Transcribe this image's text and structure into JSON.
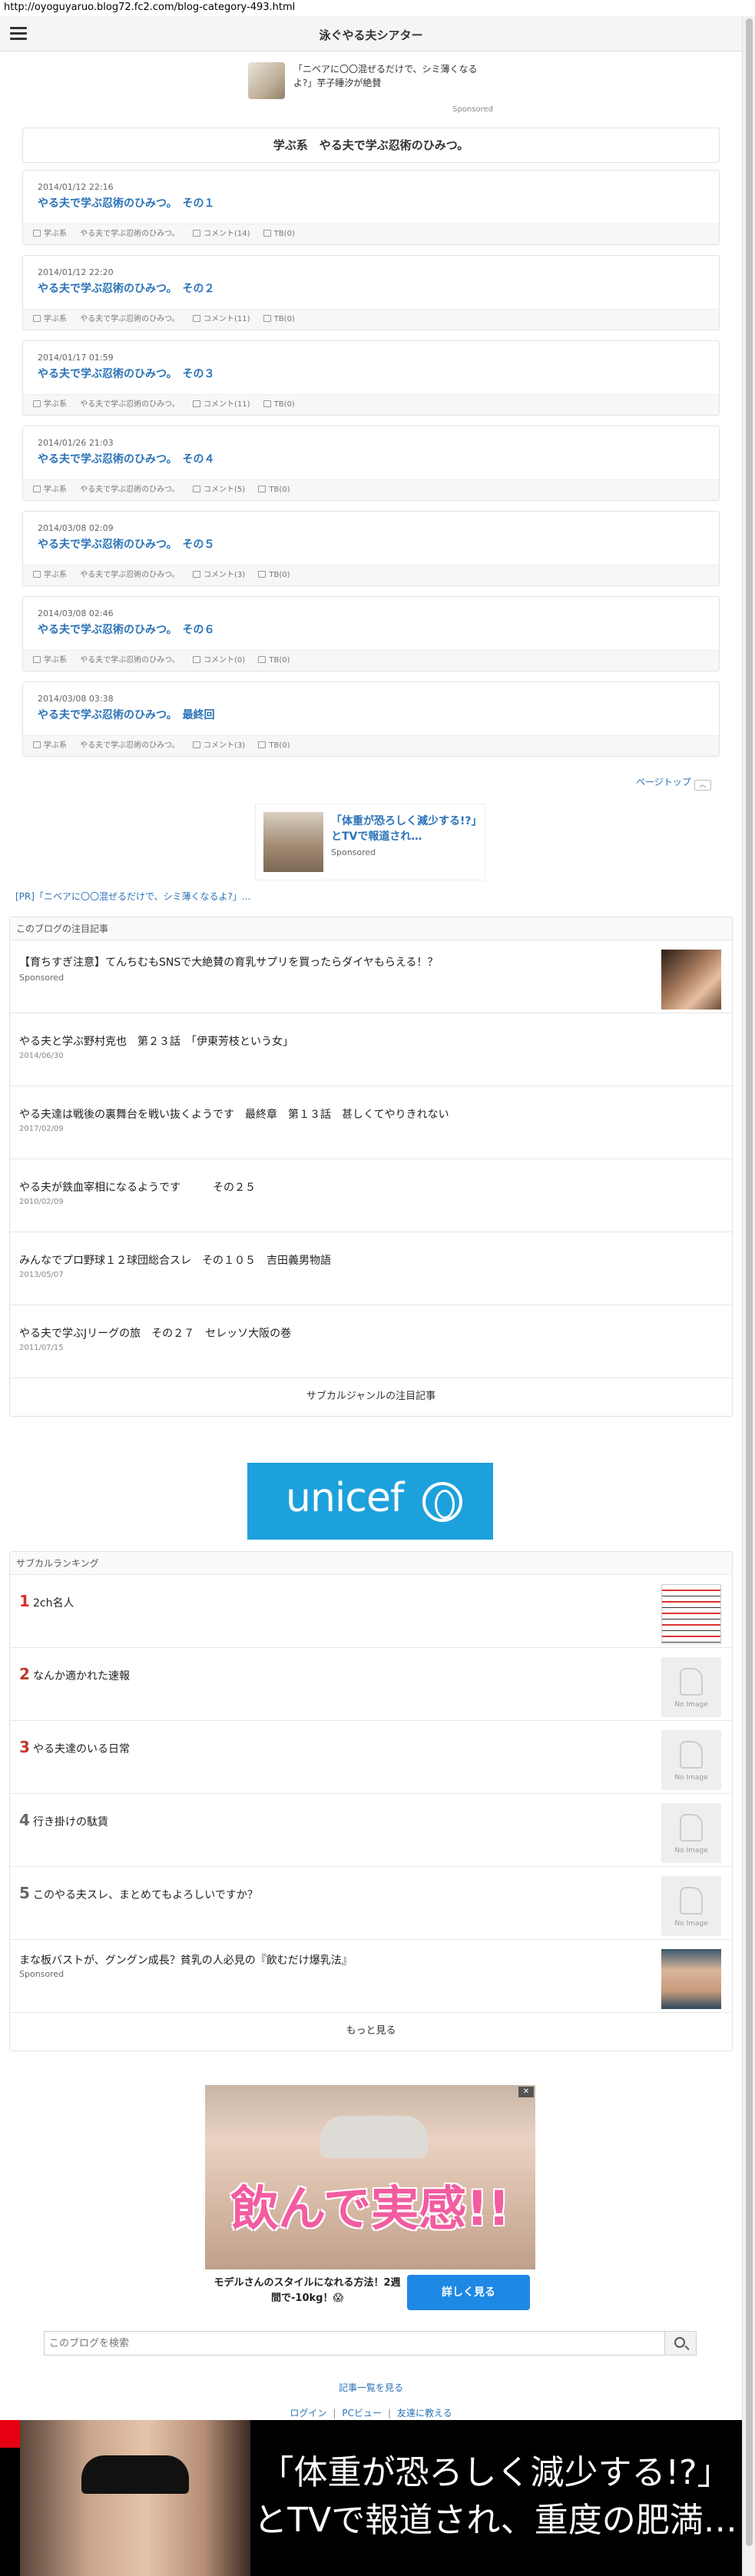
{
  "browser": {
    "url": "http://oyoguyaruo.blog72.fc2.com/blog-category-493.html"
  },
  "header": {
    "site_title": "泳ぐやる夫シアター"
  },
  "sponsor_top": {
    "text": "「ニベアに〇〇混ぜるだけで、シミ薄くなるよ?」芋子睡汐が絶賛",
    "label": "Sponsored"
  },
  "category": {
    "title": "学ぶ系　やる夫で学ぶ忍術のひみつ。"
  },
  "entries": [
    {
      "date": "2014/01/12 22:16",
      "title": "やる夫で学ぶ忍術のひみつ。　その１",
      "category": "学ぶ系",
      "series": "やる夫で学ぶ忍術のひみつ。",
      "comments": "コメント(14)",
      "tb": "TB(0)"
    },
    {
      "date": "2014/01/12 22:20",
      "title": "やる夫で学ぶ忍術のひみつ。　その２",
      "category": "学ぶ系",
      "series": "やる夫で学ぶ忍術のひみつ。",
      "comments": "コメント(11)",
      "tb": "TB(0)"
    },
    {
      "date": "2014/01/17 01:59",
      "title": "やる夫で学ぶ忍術のひみつ。　その３",
      "category": "学ぶ系",
      "series": "やる夫で学ぶ忍術のひみつ。",
      "comments": "コメント(11)",
      "tb": "TB(0)"
    },
    {
      "date": "2014/01/26 21:03",
      "title": "やる夫で学ぶ忍術のひみつ。　その４",
      "category": "学ぶ系",
      "series": "やる夫で学ぶ忍術のひみつ。",
      "comments": "コメント(5)",
      "tb": "TB(0)"
    },
    {
      "date": "2014/03/08 02:09",
      "title": "やる夫で学ぶ忍術のひみつ。　その５",
      "category": "学ぶ系",
      "series": "やる夫で学ぶ忍術のひみつ。",
      "comments": "コメント(3)",
      "tb": "TB(0)"
    },
    {
      "date": "2014/03/08 02:46",
      "title": "やる夫で学ぶ忍術のひみつ。　その６",
      "category": "学ぶ系",
      "series": "やる夫で学ぶ忍術のひみつ。",
      "comments": "コメント(0)",
      "tb": "TB(0)"
    },
    {
      "date": "2014/03/08 03:38",
      "title": "やる夫で学ぶ忍術のひみつ。　最終回",
      "category": "学ぶ系",
      "series": "やる夫で学ぶ忍術のひみつ。",
      "comments": "コメント(3)",
      "tb": "TB(0)"
    }
  ],
  "page_top": {
    "label": "ページトップ",
    "arrow": "︿"
  },
  "sponsor_mid": {
    "text": "「体重が恐ろしく減少する!?」とTVで報道され…",
    "label": "Sponsored"
  },
  "pr_link": "[PR]「ニベアに〇〇混ぜるだけで、シミ薄くなるよ?」...",
  "featured": {
    "title": "このブログの注目記事",
    "sponsored_item": {
      "title": "【育ちすぎ注意】てんちむもSNSで大絶賛の育乳サプリを買ったらダイヤもらえる！？",
      "label": "Sponsored"
    },
    "items": [
      {
        "title": "やる夫と学ぶ野村克也　第２３話　「伊東芳枝という女」",
        "date": "2014/06/30"
      },
      {
        "title": "やる夫達は戦後の裏舞台を戦い抜くようです　最終章　第１３話　甚しくてやりきれない",
        "date": "2017/02/09"
      },
      {
        "title": "やる夫が鉄血宰相になるようです　　　その２５",
        "date": "2010/02/09"
      },
      {
        "title": "みんなでプロ野球１２球団総合スレ　その１０５　吉田義男物語",
        "date": "2013/05/07"
      },
      {
        "title": "やる夫で学ぶJリーグの旅　その２７　セレッソ大阪の巻",
        "date": "2011/07/15"
      }
    ],
    "footer": "サブカルジャンルの注目記事"
  },
  "unicef": {
    "wordmark": "unicef"
  },
  "ranking": {
    "title": "サブカルランキング",
    "items": [
      {
        "rank": "1",
        "name": "2ch名人",
        "color": "#d9302e",
        "image": "thumb"
      },
      {
        "rank": "2",
        "name": "なんか適かれた速報",
        "color": "#c0392b",
        "image": "No Image"
      },
      {
        "rank": "3",
        "name": "やる夫達のいる日常",
        "color": "#c0392b",
        "image": "No Image"
      },
      {
        "rank": "4",
        "name": "行き掛けの駄賃",
        "color": "#666666",
        "image": "No Image"
      },
      {
        "rank": "5",
        "name": "このやる夫スレ、まとめてもよろしいですか？",
        "color": "#666666",
        "image": "No Image"
      }
    ],
    "sponsored_item": {
      "title": "まな板バストが、グングン成長？貧乳の人必見の『飲むだけ爆乳法』",
      "label": "Sponsored"
    },
    "footer": "もっと見る"
  },
  "big_ad": {
    "headline": "飲んで実感!!",
    "caption": "モデルさんのスタイルになれる方法！2週間で-10kg！😱",
    "button": "詳しく見る",
    "close": "✕"
  },
  "search": {
    "placeholder": "このブログを検索"
  },
  "footer": {
    "all_entries": "記事一覧を見る",
    "links": [
      "ログイン",
      "PCビュー",
      "友達に教える"
    ]
  },
  "bottom_ad": {
    "text": "「体重が恐ろしく減少する!?」とTVで報道され、重度の肥満…"
  },
  "colors": {
    "link": "#2a73b8",
    "unicef": "#1da1dc",
    "cta": "#1e88e5"
  }
}
